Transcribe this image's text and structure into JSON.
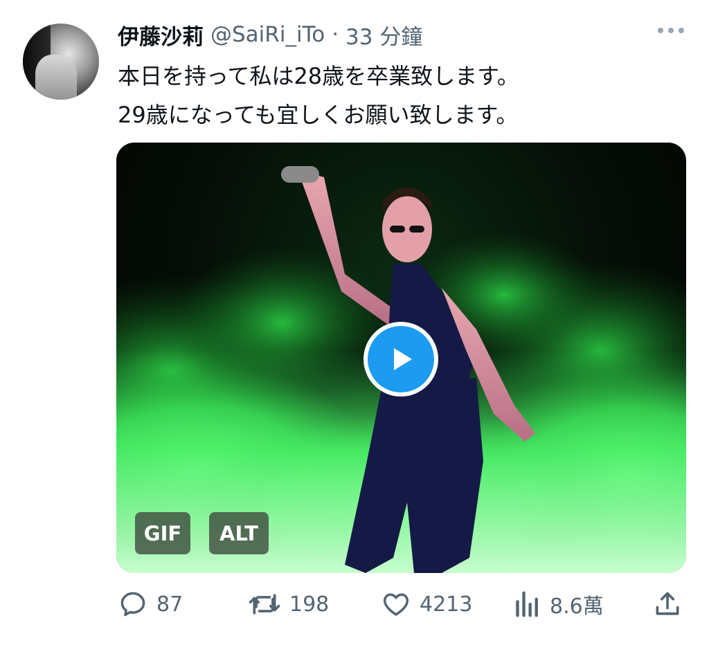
{
  "tweet": {
    "author_name": "伊藤沙莉",
    "handle": "@SaiRi_iTo",
    "separator": "·",
    "time": "33 分鐘",
    "text_lines": [
      "本日を持って私は28歳を卒業致します。",
      "29歳になっても宜しくお願い致します。"
    ]
  },
  "media": {
    "badges": {
      "gif": "GIF",
      "alt": "ALT"
    }
  },
  "actions": {
    "replies": "87",
    "retweets": "198",
    "likes": "4213",
    "views": "8.6萬"
  },
  "colors": {
    "accent": "#1d9bf0",
    "secondary_text": "#536471",
    "smoke_green": "#3cf05a"
  },
  "icons": {
    "more": "more-icon",
    "reply": "reply-icon",
    "retweet": "retweet-icon",
    "like": "heart-icon",
    "views": "views-chart-icon",
    "share": "share-icon",
    "play": "play-icon"
  }
}
